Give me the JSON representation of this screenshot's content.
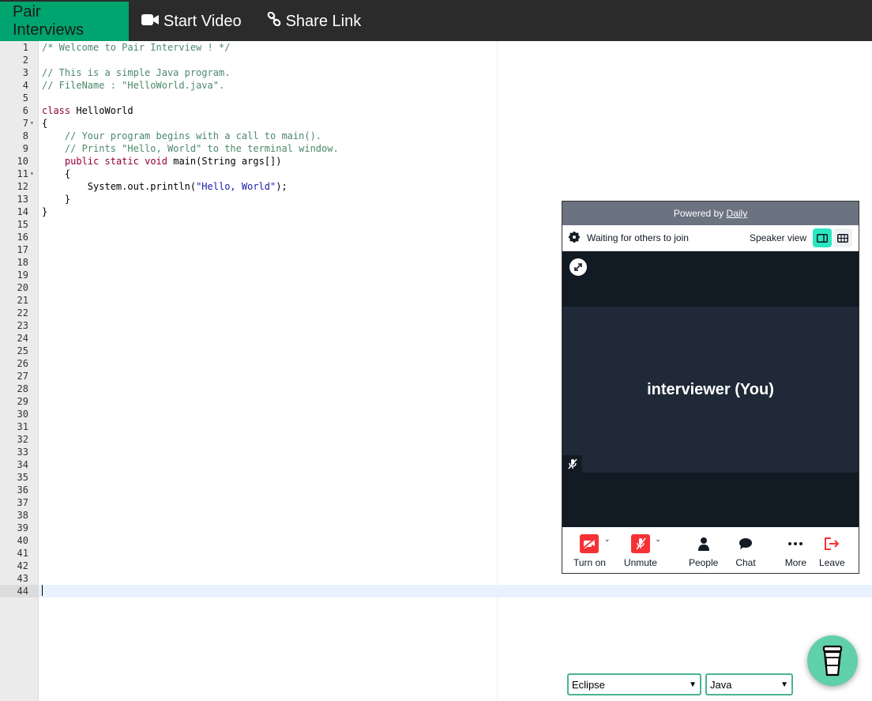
{
  "nav": {
    "brand": "Pair Interviews",
    "start_video": "Start Video",
    "share_link": "Share Link"
  },
  "editor": {
    "active_line": 44,
    "fold_lines": [
      7,
      11
    ],
    "lines": [
      "/* Welcome to Pair Interview ! */",
      "",
      "// This is a simple Java program.",
      "// FileName : \"HelloWorld.java\".",
      "",
      "class HelloWorld",
      "{",
      "    // Your program begins with a call to main().",
      "    // Prints \"Hello, World\" to the terminal window.",
      "    public static void main(String args[])",
      "    {",
      "        System.out.println(\"Hello, World\");",
      "    }",
      "}"
    ],
    "total_lines": 44
  },
  "video": {
    "powered_prefix": "Powered by ",
    "powered_link": "Daily",
    "status": "Waiting for others to join",
    "view_label": "Speaker view",
    "participant": "interviewer (You)",
    "tray": {
      "camera": "Turn on",
      "mic": "Unmute",
      "people": "People",
      "chat": "Chat",
      "more": "More",
      "leave": "Leave"
    }
  },
  "controls": {
    "theme": "Eclipse",
    "language": "Java"
  },
  "colors": {
    "brand": "#00a46e",
    "accent": "#2be7c1",
    "danger": "#f63135"
  }
}
